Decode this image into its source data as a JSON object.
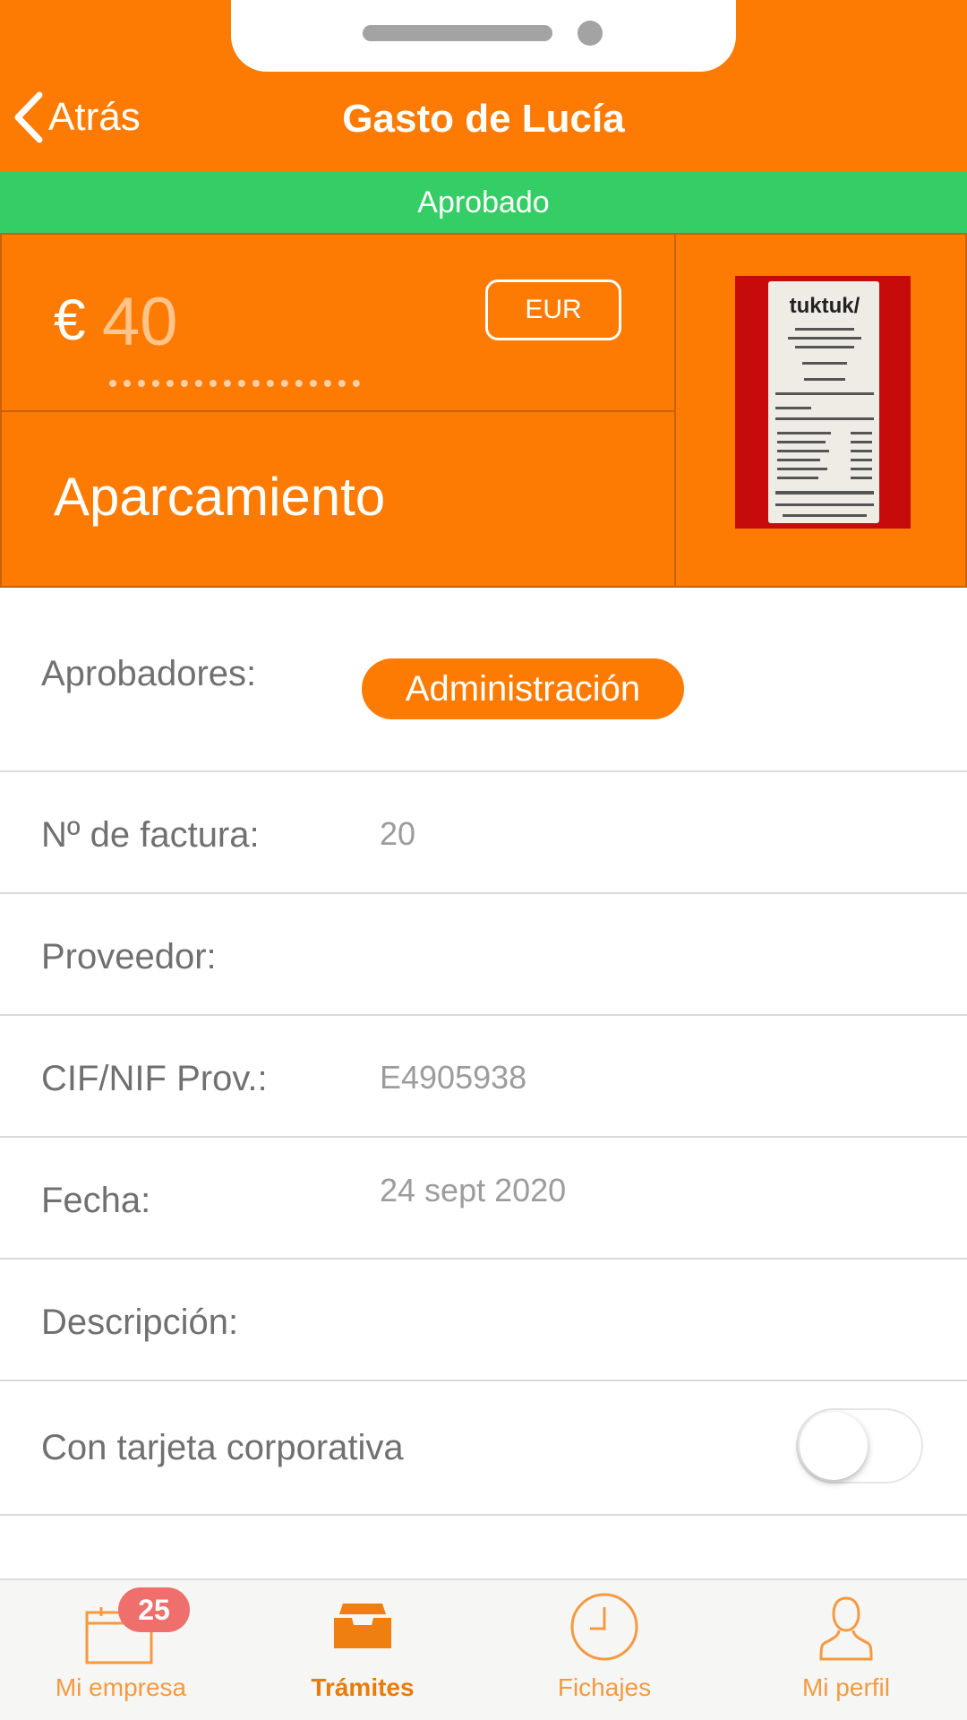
{
  "header": {
    "back_label": "Atrás",
    "title": "Gasto de Lucía",
    "back_icon": "chevron-left-icon"
  },
  "status": {
    "label": "Aprobado",
    "color": "#35CD65"
  },
  "expense": {
    "currency_symbol": "€",
    "amount": "40",
    "currency_code": "EUR",
    "category": "Aparcamiento",
    "receipt_brand": "tuktuk/"
  },
  "form": {
    "approvers_label": "Aprobadores:",
    "approver_tag": "Administración",
    "invoice_label": "Nº de factura:",
    "invoice_value": "20",
    "supplier_label": "Proveedor:",
    "supplier_value": "",
    "tax_id_label": "CIF/NIF Prov.:",
    "tax_id_value": "E4905938",
    "date_label": "Fecha:",
    "date_value": "24 sept 2020",
    "description_label": "Descripción:",
    "description_value": "",
    "corporate_card_label": "Con tarjeta corporativa",
    "corporate_card_on": false
  },
  "tabs": [
    {
      "label": "Mi empresa",
      "icon": "calendar-icon",
      "badge": "25",
      "active": false
    },
    {
      "label": "Trámites",
      "icon": "inbox-tray-icon",
      "active": true
    },
    {
      "label": "Fichajes",
      "icon": "clock-icon",
      "active": false
    },
    {
      "label": "Mi perfil",
      "icon": "user-icon",
      "active": false
    }
  ],
  "colors": {
    "brand": "#FD7B02",
    "approved": "#35CD65",
    "badge": "#EE6F6B"
  }
}
